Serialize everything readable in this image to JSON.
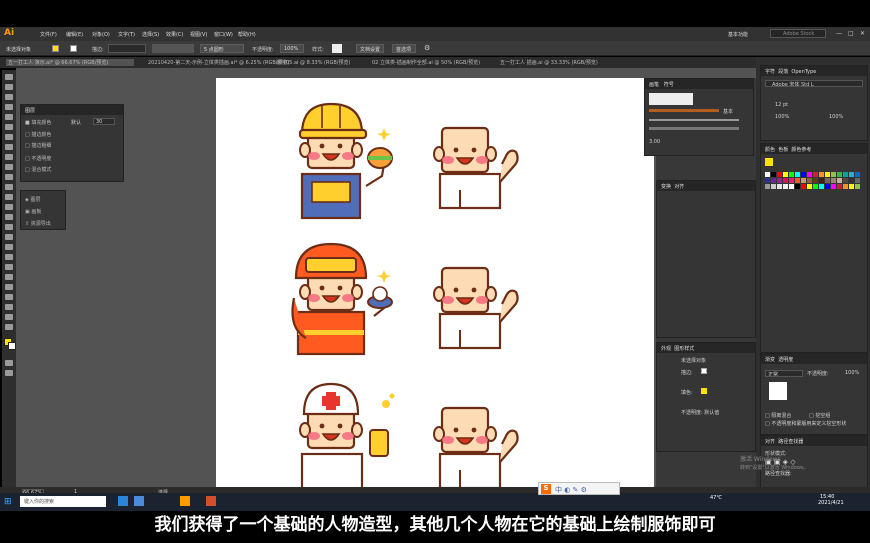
{
  "app": {
    "logo": "Ai",
    "workspace": "基本功能",
    "search_placeholder": "Adobe Stock"
  },
  "menu": [
    "文件(F)",
    "编辑(E)",
    "对象(O)",
    "文字(T)",
    "选择(S)",
    "效果(C)",
    "视图(V)",
    "窗口(W)",
    "帮助(H)"
  ],
  "control_bar": {
    "selection": "未选择对象",
    "stroke_label": "描边:",
    "stroke_size": "5 点圆形",
    "opacity_label": "不透明度:",
    "opacity": "100%",
    "style_label": "样式:",
    "doc_setup": "文档设置",
    "prefs": "首选项"
  },
  "doc_tabs": [
    "五一打工人 演示.ai* @ 66.67% (RGB/预览)",
    "20210420-第二天-示例-立体类插画.ai* @ 6.25% (RGB/预览)",
    "课件05.ai @ 8.33% (RGB/预览)",
    "02 立体类-插画制作全部.ai @ 50% (RGB/预览)",
    "五一打工人 插画.ai @ 33.33% (RGB/预览)"
  ],
  "appearance_float": {
    "title": "图层",
    "rows": [
      "填充颜色",
      "描边颜色",
      "描边粗细",
      "不透明度",
      "混合模式"
    ],
    "value_label": "默认",
    "size_value": "30"
  },
  "libraries_float": {
    "rows": [
      "图层",
      "画板",
      "资源导出"
    ]
  },
  "stroke_panel": {
    "tabs": [
      "画笔",
      "符号"
    ],
    "basic": "基本",
    "weight": "3.00"
  },
  "transform_panel": {
    "tabs": [
      "变换",
      "对齐"
    ]
  },
  "appearance_panel": {
    "tabs": [
      "外观",
      "图形样式"
    ],
    "object": "未选择对象",
    "rows": [
      "描边:",
      "填色:",
      "不透明度: 默认值"
    ],
    "opacity": "默认值"
  },
  "char_panel": {
    "tabs": [
      "字符",
      "段落",
      "OpenType"
    ],
    "font": "Adobe 宋体 Std L",
    "size": "12 pt",
    "scale": "100%"
  },
  "color_panel": {
    "tabs": [
      "颜色",
      "色板",
      "颜色参考"
    ]
  },
  "transparency_panel": {
    "tabs": [
      "渐变",
      "透明度"
    ],
    "mode": "正常",
    "opacity_label": "不透明度:",
    "opacity": "100%",
    "options": [
      "隔离混合",
      "挖空组",
      "不透明度和蒙版用来定义挖空形状"
    ]
  },
  "pathfinder_panel": {
    "tabs": [
      "对齐",
      "路径查找器"
    ],
    "shape_modes": "形状模式:",
    "pathfinders": "路径查找器:"
  },
  "status": {
    "zoom": "66.67%",
    "page": "1",
    "mode": "选择"
  },
  "taskbar": {
    "search": "键入你的搜索",
    "weather": "47℃",
    "time": "15:40",
    "date": "2021/4/21"
  },
  "watermark": [
    "激活 Windows",
    "转到\"设置\"以激活 Windows。"
  ],
  "subtitle": "我们获得了一个基础的人物造型，其他几个人物在它的基础上绘制服饰即可",
  "colors": {
    "accent": "#ff9a00",
    "skin": "#fddcb5",
    "outline": "#6b2d16",
    "helmet": "#ffcf2e",
    "fire": "#ff5a1f",
    "cheek": "#f3697d"
  }
}
